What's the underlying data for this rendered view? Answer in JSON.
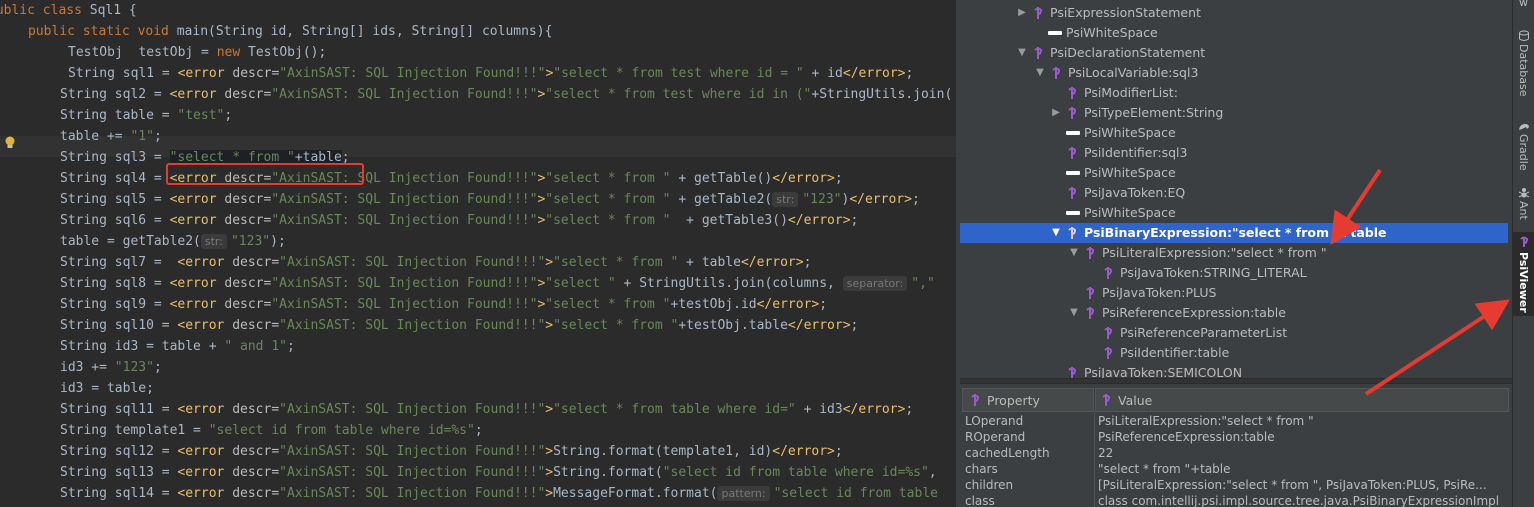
{
  "editor": {
    "lines": [
      {
        "segs": [
          [
            "kw",
            "public class "
          ],
          [
            "",
            "Sql1 {"
          ]
        ]
      },
      {
        "segs": [
          [
            "kw",
            "public static void "
          ],
          [
            "",
            "main(String id, String[] ids, String[] columns){"
          ]
        ]
      },
      {
        "segs": [
          [
            "",
            "TestObj  testObj = "
          ],
          [
            "kw",
            "new "
          ],
          [
            "",
            "TestObj();"
          ]
        ]
      },
      {
        "segs": [
          [
            "",
            "String sql1 = "
          ],
          [
            "tag",
            "<error "
          ],
          [
            "attr",
            "descr="
          ],
          [
            "str",
            "\"AxinSAST: SQL Injection Found!!!\""
          ],
          [
            "tag",
            ">"
          ],
          [
            "str",
            "\"select * from test where id = \""
          ],
          [
            "",
            " + id"
          ],
          [
            "tag",
            "</error>"
          ],
          [
            "",
            ";"
          ]
        ]
      },
      {
        "segs": [
          [
            "",
            "String sql2 = "
          ],
          [
            "tag",
            "<error "
          ],
          [
            "attr",
            "descr="
          ],
          [
            "str",
            "\"AxinSAST: SQL Injection Found!!!\""
          ],
          [
            "tag",
            ">"
          ],
          [
            "str",
            "\"select * from test where id in (\""
          ],
          [
            "",
            "+StringUtils.join("
          ]
        ]
      },
      {
        "segs": [
          [
            "",
            "String table = "
          ],
          [
            "str",
            "\"test\""
          ],
          [
            "",
            ";"
          ]
        ]
      },
      {
        "segs": [
          [
            "",
            "table += "
          ],
          [
            "str",
            "\"1\""
          ],
          [
            "",
            ";"
          ]
        ]
      },
      {
        "segs": [
          [
            "",
            "String sql3 = "
          ],
          [
            "strsel",
            "\"select * from \""
          ],
          [
            "sel",
            "+table"
          ],
          [
            "",
            ";"
          ]
        ]
      },
      {
        "segs": [
          [
            "",
            "String sql4 = "
          ],
          [
            "tag",
            "<error "
          ],
          [
            "attr",
            "descr="
          ],
          [
            "str",
            "\"AxinSAST: SQL Injection Found!!!\""
          ],
          [
            "tag",
            ">"
          ],
          [
            "str",
            "\"select * from \""
          ],
          [
            "",
            " + getTable()"
          ],
          [
            "tag",
            "</error>"
          ],
          [
            "",
            ";"
          ]
        ]
      },
      {
        "segs": [
          [
            "",
            "String sql5 = "
          ],
          [
            "tag",
            "<error "
          ],
          [
            "attr",
            "descr="
          ],
          [
            "str",
            "\"AxinSAST: SQL Injection Found!!!\""
          ],
          [
            "tag",
            ">"
          ],
          [
            "str",
            "\"select * from \""
          ],
          [
            "",
            " + getTable2("
          ],
          [
            "hint",
            "str:"
          ],
          [
            "str",
            "\"123\""
          ],
          [
            "",
            ")"
          ],
          [
            "tag",
            "</error>"
          ],
          [
            "",
            ";"
          ]
        ]
      },
      {
        "segs": [
          [
            "",
            "String sql6 = "
          ],
          [
            "tag",
            "<error "
          ],
          [
            "attr",
            "descr="
          ],
          [
            "str",
            "\"AxinSAST: SQL Injection Found!!!\""
          ],
          [
            "tag",
            ">"
          ],
          [
            "str",
            "\"select * from \""
          ],
          [
            "",
            "  + getTable3()"
          ],
          [
            "tag",
            "</error>"
          ],
          [
            "",
            ";"
          ]
        ]
      },
      {
        "segs": [
          [
            "",
            "table = getTable2("
          ],
          [
            "hint",
            "str:"
          ],
          [
            "str",
            "\"123\""
          ],
          [
            "",
            ");"
          ]
        ]
      },
      {
        "segs": [
          [
            "",
            "String sql7 =  "
          ],
          [
            "tag",
            "<error "
          ],
          [
            "attr",
            "descr="
          ],
          [
            "str",
            "\"AxinSAST: SQL Injection Found!!!\""
          ],
          [
            "tag",
            ">"
          ],
          [
            "str",
            "\"select * from \""
          ],
          [
            "",
            " + table"
          ],
          [
            "tag",
            "</error>"
          ],
          [
            "",
            ";"
          ]
        ]
      },
      {
        "segs": [
          [
            "",
            "String sql8 = "
          ],
          [
            "tag",
            "<error "
          ],
          [
            "attr",
            "descr="
          ],
          [
            "str",
            "\"AxinSAST: SQL Injection Found!!!\""
          ],
          [
            "tag",
            ">"
          ],
          [
            "str",
            "\"select \""
          ],
          [
            "",
            " + StringUtils.join(columns, "
          ],
          [
            "hint",
            "separator:"
          ],
          [
            "str",
            "\",\""
          ]
        ]
      },
      {
        "segs": [
          [
            "",
            "String sql9 = "
          ],
          [
            "tag",
            "<error "
          ],
          [
            "attr",
            "descr="
          ],
          [
            "str",
            "\"AxinSAST: SQL Injection Found!!!\""
          ],
          [
            "tag",
            ">"
          ],
          [
            "str",
            "\"select * from \""
          ],
          [
            "",
            "+testObj.id"
          ],
          [
            "tag",
            "</error>"
          ],
          [
            "",
            ";"
          ]
        ]
      },
      {
        "segs": [
          [
            "",
            "String sql10 = "
          ],
          [
            "tag",
            "<error "
          ],
          [
            "attr",
            "descr="
          ],
          [
            "str",
            "\"AxinSAST: SQL Injection Found!!!\""
          ],
          [
            "tag",
            ">"
          ],
          [
            "str",
            "\"select * from \""
          ],
          [
            "",
            "+testObj.table"
          ],
          [
            "tag",
            "</error>"
          ],
          [
            "",
            ";"
          ]
        ]
      },
      {
        "segs": [
          [
            "",
            "String id3 = table + "
          ],
          [
            "str",
            "\" and 1\""
          ],
          [
            "",
            ";"
          ]
        ]
      },
      {
        "segs": [
          [
            "",
            "id3 += "
          ],
          [
            "str",
            "\"123\""
          ],
          [
            "",
            ";"
          ]
        ]
      },
      {
        "segs": [
          [
            "",
            "id3 = table;"
          ]
        ]
      },
      {
        "segs": [
          [
            "",
            "String sql11 = "
          ],
          [
            "tag",
            "<error "
          ],
          [
            "attr",
            "descr="
          ],
          [
            "str",
            "\"AxinSAST: SQL Injection Found!!!\""
          ],
          [
            "tag",
            ">"
          ],
          [
            "str",
            "\"select * from table where id=\""
          ],
          [
            "",
            " + id3"
          ],
          [
            "tag",
            "</error>"
          ],
          [
            "",
            ";"
          ]
        ]
      },
      {
        "segs": [
          [
            "",
            "String template1 = "
          ],
          [
            "str",
            "\"select id from table where id=%s\""
          ],
          [
            "",
            ";"
          ]
        ]
      },
      {
        "segs": [
          [
            "",
            "String sql12 = "
          ],
          [
            "tag",
            "<error "
          ],
          [
            "attr",
            "descr="
          ],
          [
            "str",
            "\"AxinSAST: SQL Injection Found!!!\""
          ],
          [
            "tag",
            ">"
          ],
          [
            "",
            "String.format(template1, id)"
          ],
          [
            "tag",
            "</error>"
          ],
          [
            "",
            ";"
          ]
        ]
      },
      {
        "segs": [
          [
            "",
            "String sql13 = "
          ],
          [
            "tag",
            "<error "
          ],
          [
            "attr",
            "descr="
          ],
          [
            "str",
            "\"AxinSAST: SQL Injection Found!!!\""
          ],
          [
            "tag",
            ">"
          ],
          [
            "",
            "String.format("
          ],
          [
            "str",
            "\"select id from table where id=%s\""
          ],
          [
            "",
            ","
          ]
        ]
      },
      {
        "segs": [
          [
            "",
            "String sql14 = "
          ],
          [
            "tag",
            "<error "
          ],
          [
            "attr",
            "descr="
          ],
          [
            "str",
            "\"AxinSAST: SQL Injection Found!!!\""
          ],
          [
            "tag",
            ">"
          ],
          [
            "",
            "MessageFormat.format("
          ],
          [
            "hint",
            "pattern:"
          ],
          [
            "str",
            "\"select id from table"
          ]
        ]
      },
      {
        "segs": [
          [
            "",
            "}"
          ]
        ]
      }
    ]
  },
  "tree": {
    "rows": [
      {
        "label": "PsiExpressionStatement",
        "arrow": "▶",
        "icon": "psi",
        "selected": false
      },
      {
        "label": "PsiWhiteSpace",
        "arrow": "",
        "icon": "ws",
        "selected": false
      },
      {
        "label": "PsiDeclarationStatement",
        "arrow": "▼",
        "icon": "psi",
        "selected": false
      },
      {
        "label": "PsiLocalVariable:sql3",
        "arrow": "▼",
        "icon": "psi",
        "selected": false
      },
      {
        "label": "PsiModifierList:",
        "arrow": "",
        "icon": "psi",
        "selected": false
      },
      {
        "label": "PsiTypeElement:String",
        "arrow": "▶",
        "icon": "psi",
        "selected": false
      },
      {
        "label": "PsiWhiteSpace",
        "arrow": "",
        "icon": "ws",
        "selected": false
      },
      {
        "label": "PsiIdentifier:sql3",
        "arrow": "",
        "icon": "psi",
        "selected": false
      },
      {
        "label": "PsiWhiteSpace",
        "arrow": "",
        "icon": "ws",
        "selected": false
      },
      {
        "label": "PsiJavaToken:EQ",
        "arrow": "",
        "icon": "psi",
        "selected": false
      },
      {
        "label": "PsiWhiteSpace",
        "arrow": "",
        "icon": "ws",
        "selected": false
      },
      {
        "label": "PsiBinaryExpression:\"select * from \"+table",
        "arrow": "▼",
        "icon": "psi",
        "selected": true
      },
      {
        "label": "PsiLiteralExpression:\"select * from \"",
        "arrow": "▼",
        "icon": "psi",
        "selected": false
      },
      {
        "label": "PsiJavaToken:STRING_LITERAL",
        "arrow": "",
        "icon": "psi",
        "selected": false
      },
      {
        "label": "PsiJavaToken:PLUS",
        "arrow": "",
        "icon": "psi",
        "selected": false
      },
      {
        "label": "PsiReferenceExpression:table",
        "arrow": "▼",
        "icon": "psi",
        "selected": false
      },
      {
        "label": "PsiReferenceParameterList",
        "arrow": "",
        "icon": "psi",
        "selected": false
      },
      {
        "label": "PsiIdentifier:table",
        "arrow": "",
        "icon": "psi",
        "selected": false
      },
      {
        "label": "PsiJavaToken:SEMICOLON",
        "arrow": "",
        "icon": "psi",
        "selected": false
      }
    ]
  },
  "properties": {
    "header": {
      "property": "Property",
      "value": "Value"
    },
    "rows": [
      {
        "key": "LOperand",
        "value": "PsiLiteralExpression:\"select * from \""
      },
      {
        "key": "ROperand",
        "value": "PsiReferenceExpression:table"
      },
      {
        "key": "cachedLength",
        "value": "22"
      },
      {
        "key": "chars",
        "value": "\"select * from \"+table"
      },
      {
        "key": "children",
        "value": "[PsiLiteralExpression:\"select * from \", PsiJavaToken:PLUS, PsiRe..."
      },
      {
        "key": "class",
        "value": "class com.intellij.psi.impl.source.tree.java.PsiBinaryExpressionImpl"
      }
    ]
  },
  "toolstrip": {
    "top_label": "w",
    "items": [
      {
        "label": "Database",
        "icon": "database-icon",
        "active": false
      },
      {
        "label": "Gradle",
        "icon": "gradle-icon",
        "active": false
      },
      {
        "label": "Ant",
        "icon": "ant-icon",
        "active": false
      },
      {
        "label": "PsiViewer",
        "icon": "psi-icon",
        "active": true
      }
    ]
  },
  "colors": {
    "editor_bg": "#2b2b2b",
    "keyword": "#cc7832",
    "string": "#6a8759",
    "tag": "#e8bf6a",
    "selection": "#2f65ca",
    "annotation_red": "#e53b30",
    "psi_icon": "#9b59d0"
  }
}
